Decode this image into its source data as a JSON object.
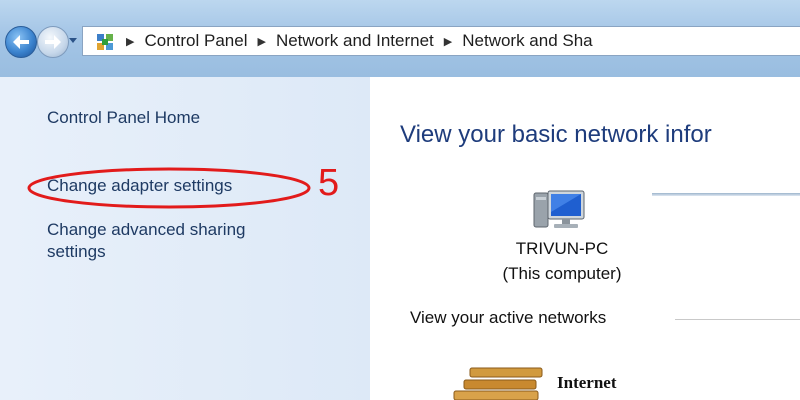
{
  "address_bar": {
    "breadcrumbs": [
      "Control Panel",
      "Network and Internet",
      "Network and Sha"
    ]
  },
  "left_pane": {
    "links": [
      {
        "label": "Control Panel Home"
      },
      {
        "label": "Change adapter settings"
      },
      {
        "label": "Change advanced sharing settings"
      }
    ]
  },
  "annotation": {
    "step_number": "5",
    "color": "#e21b1b"
  },
  "main": {
    "title": "View your basic network infor",
    "computer": {
      "name": "TRIVUN-PC",
      "subtitle": "(This computer)",
      "icon": "computer-icon"
    },
    "active_networks_label": "View your active networks",
    "network": {
      "name": "Internet",
      "icon": "bench-icon"
    }
  }
}
